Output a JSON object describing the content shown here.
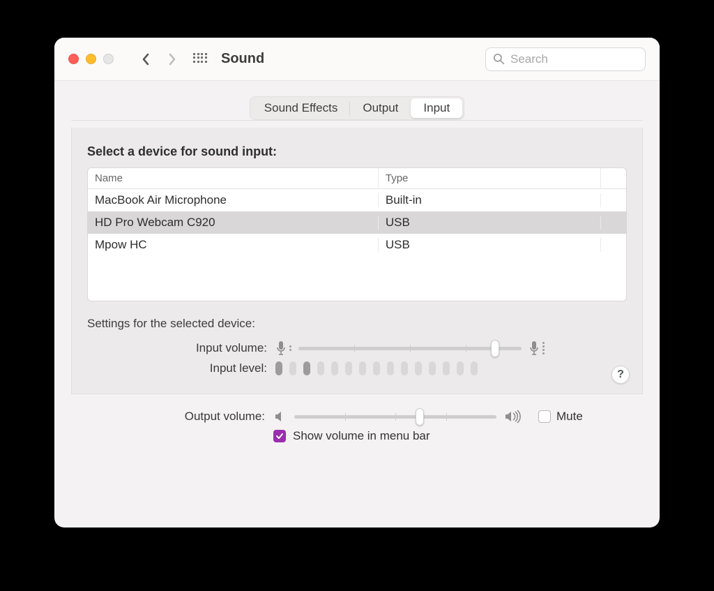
{
  "window": {
    "title": "Sound"
  },
  "search": {
    "placeholder": "Search",
    "value": ""
  },
  "tabs": [
    {
      "label": "Sound Effects",
      "active": false
    },
    {
      "label": "Output",
      "active": false
    },
    {
      "label": "Input",
      "active": true
    }
  ],
  "section_title": "Select a device for sound input:",
  "table": {
    "headers": {
      "name": "Name",
      "type": "Type"
    },
    "rows": [
      {
        "name": "MacBook Air Microphone",
        "type": "Built-in",
        "selected": false
      },
      {
        "name": "HD Pro Webcam C920",
        "type": "USB",
        "selected": true
      },
      {
        "name": "Mpow HC",
        "type": "USB",
        "selected": false
      }
    ]
  },
  "settings_title": "Settings for the selected device:",
  "input_volume": {
    "label": "Input volume:",
    "value": 0.88
  },
  "input_level": {
    "label": "Input level:",
    "segments": 15,
    "lit": [
      0,
      2
    ]
  },
  "output_volume": {
    "label": "Output volume:",
    "value": 0.62
  },
  "mute": {
    "label": "Mute",
    "checked": false
  },
  "show_menu": {
    "label": "Show volume in menu bar",
    "checked": true
  },
  "help": "?"
}
